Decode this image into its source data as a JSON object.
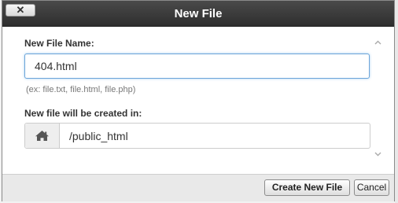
{
  "dialog": {
    "title": "New File",
    "close_label": "✕"
  },
  "form": {
    "name_label": "New File Name:",
    "name_value": "404.html",
    "name_hint": "(ex: file.txt, file.html, file.php)",
    "location_label": "New file will be created in:",
    "location_value": "/public_html",
    "location_icon": "home-icon"
  },
  "footer": {
    "create_label": "Create New File",
    "cancel_label": "Cancel"
  }
}
